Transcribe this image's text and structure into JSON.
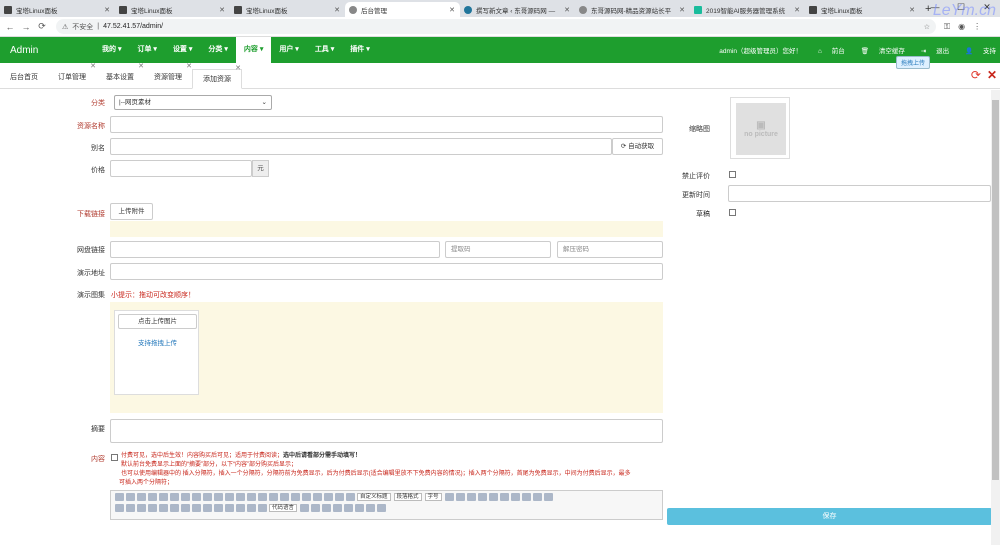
{
  "browser": {
    "tabs": [
      {
        "label": "宝塔Linux面板",
        "icon": "bt-icon"
      },
      {
        "label": "宝塔Linux面板",
        "icon": "bt-icon"
      },
      {
        "label": "宝塔Linux面板",
        "icon": "bt-icon"
      },
      {
        "label": "后台管理",
        "icon": "globe-icon",
        "active": true
      },
      {
        "label": "撰写新文章 ‹ 东哥源码网 —",
        "icon": "wordpress-icon"
      },
      {
        "label": "东哥源码网-精品资源站长平",
        "icon": "globe-icon"
      },
      {
        "label": "2019智能AI服务器管理系统",
        "icon": "t-icon"
      },
      {
        "label": "宝塔Linux面板",
        "icon": "bt-icon"
      }
    ],
    "new_tab": "+",
    "insecure_label": "不安全",
    "url": "47.52.41.57/admin/",
    "watermark": "LeYm.cn"
  },
  "topnav": {
    "brand": "Admin",
    "menu": [
      "我的 ▾",
      "订单 ▾",
      "设置 ▾",
      "分类 ▾",
      "内容 ▾",
      "用户 ▾",
      "工具 ▾",
      "插件 ▾"
    ],
    "active_index": 4,
    "user": "admin（超级管理员）您好！",
    "home": "前台",
    "clear_cache": "清空缓存",
    "logout": "退出",
    "support": "支持"
  },
  "tooltip": "拖拽上传",
  "page_tabs": [
    "后台首页",
    "订单管理",
    "基本设置",
    "资源管理",
    "添加资源"
  ],
  "active_page_tab": 4,
  "form": {
    "category_label": "分类",
    "category_value": "|--网页素材",
    "name_label": "资源名称",
    "alias_label": "别名",
    "auto_fetch": "自动获取",
    "price_label": "价格",
    "price_unit": "元",
    "download_label": "下载链接",
    "upload_attachment": "上传附件",
    "netdisk_label": "网盘链接",
    "extract_placeholder": "提取码",
    "unzip_placeholder": "解压密码",
    "demo_label": "演示地址",
    "gallery_label": "演示图集",
    "gallery_hint": "小提示：拖动可改变顺序！",
    "click_upload": "点击上传图片",
    "drag_upload": "支持拖拽上传",
    "summary_label": "摘要",
    "content_label": "内容",
    "pay_line1_a": "付费可见，选中后生效！内容购买后可见；适用于付费阅读；",
    "pay_line1_b": "选中后请看部分需手动填写！",
    "pay_line2": "默认前台免费显示上面的“摘要”部分，以下“内容”部分购买后显示；",
    "pay_line3": "也可以使用编辑器中的 插入分隔符，插入一个分隔符，分隔符前为免费显示，后为付费后显示(适合编辑里放不下免费内容的情况)；插入两个分隔符，首尾为免费显示，中间为付费后显示，最多",
    "pay_line4": "可插入两个分隔符；",
    "editor_selects": [
      "自定义标题",
      "段落格式",
      "字号"
    ],
    "editor_code_lang": "代码语言",
    "thumb_label": "缩略图",
    "thumb_placeholder": "no picture",
    "disable_comment_label": "禁止评价",
    "update_time_label": "更新时间",
    "draft_label": "草稿",
    "save": "保存"
  }
}
